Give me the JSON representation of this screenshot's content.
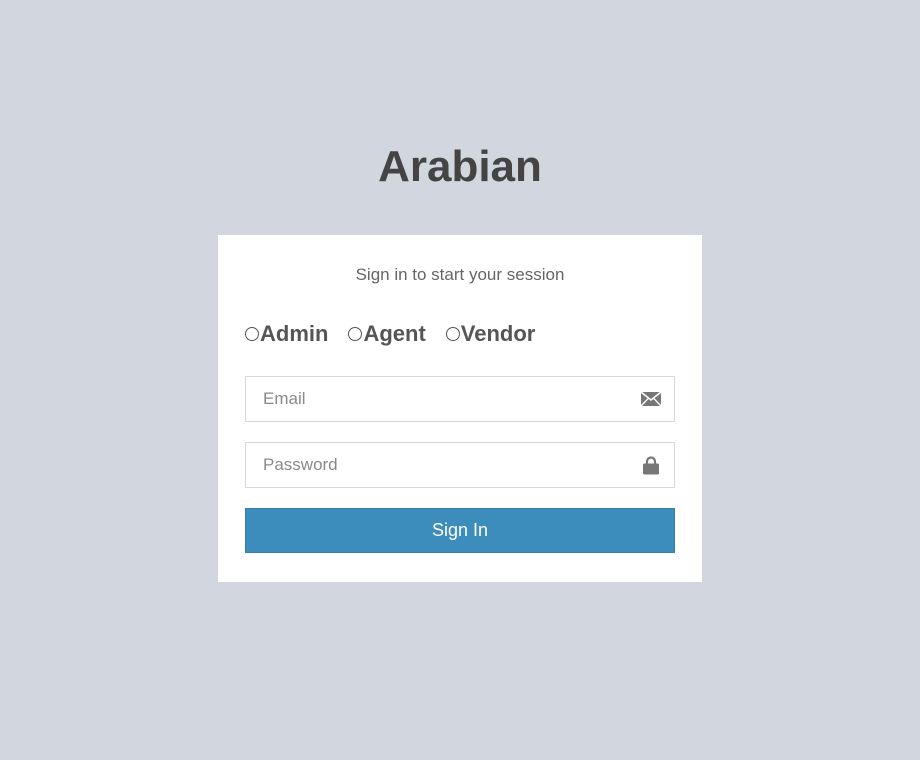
{
  "app": {
    "logo_text": "Arabian"
  },
  "login": {
    "message": "Sign in to start your session",
    "roles": [
      {
        "label": "Admin",
        "selected": false
      },
      {
        "label": "Agent",
        "selected": false
      },
      {
        "label": "Vendor",
        "selected": false
      }
    ],
    "email": {
      "placeholder": "Email",
      "value": "",
      "icon": "envelope-icon"
    },
    "password": {
      "placeholder": "Password",
      "value": "",
      "icon": "lock-icon"
    },
    "submit_label": "Sign In"
  },
  "colors": {
    "background": "#d2d6de",
    "panel": "#ffffff",
    "primary_button": "#3c8dbc",
    "heading_text": "#444444",
    "icon": "#777777"
  }
}
